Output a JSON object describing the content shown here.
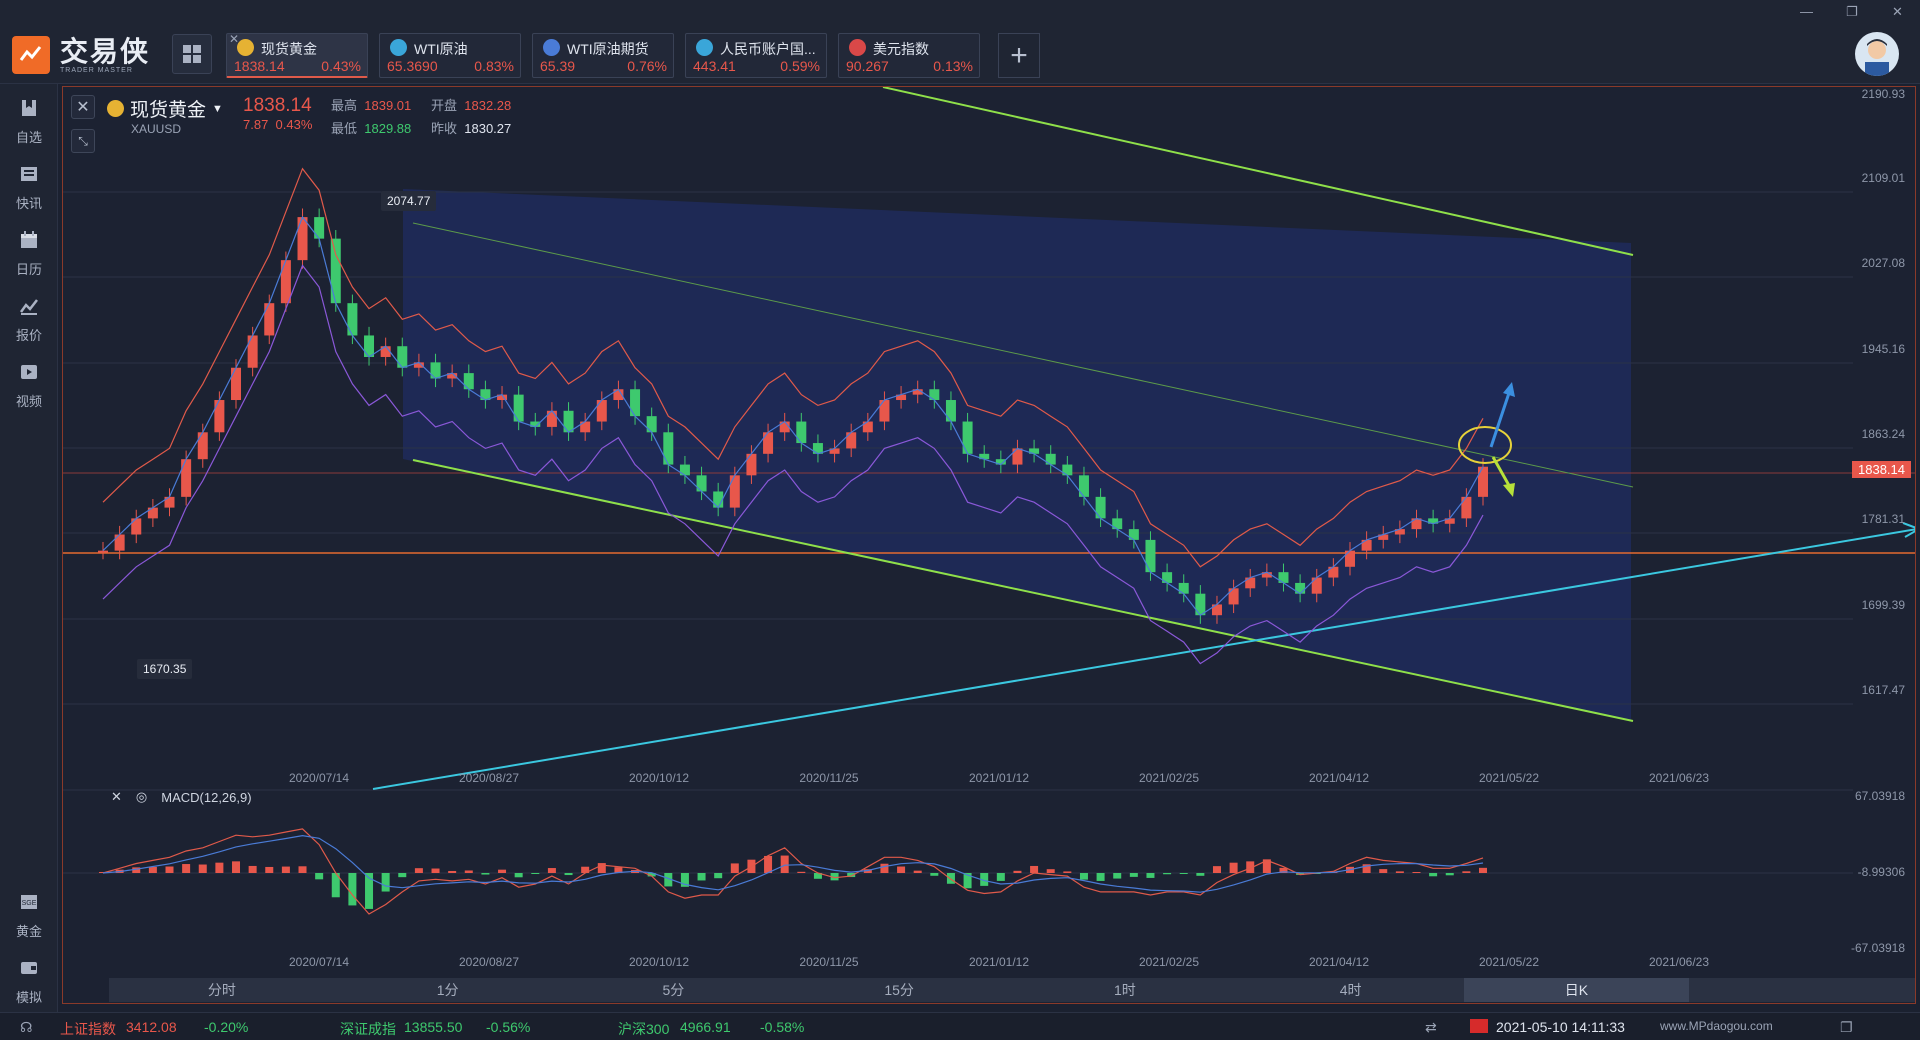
{
  "app": {
    "name_cn": "交易侠",
    "name_en": "TRADER MASTER"
  },
  "tabs": [
    {
      "name": "现货黄金",
      "price": "1838.14",
      "change": "0.43%",
      "active": true,
      "badge_color": "#e6b233"
    },
    {
      "name": "WTI原油",
      "price": "65.3690",
      "change": "0.83%",
      "active": false,
      "badge_color": "#3aa6d9"
    },
    {
      "name": "WTI原油期货",
      "price": "65.39",
      "change": "0.76%",
      "active": false,
      "badge_color": "#4a7bd6"
    },
    {
      "name": "人民币账户国...",
      "price": "443.41",
      "change": "0.59%",
      "active": false,
      "badge_color": "#3aa6d9"
    },
    {
      "name": "美元指数",
      "price": "90.267",
      "change": "0.13%",
      "active": false,
      "badge_color": "#d94848"
    }
  ],
  "sidebar": {
    "items": [
      {
        "label": "自选",
        "icon": "bookmark-icon"
      },
      {
        "label": "快讯",
        "icon": "news-icon"
      },
      {
        "label": "日历",
        "icon": "calendar-icon"
      },
      {
        "label": "报价",
        "icon": "quote-icon"
      },
      {
        "label": "视频",
        "icon": "video-icon"
      },
      {
        "label": "黄金",
        "icon": "sge-icon"
      },
      {
        "label": "模拟",
        "icon": "simulate-icon"
      }
    ]
  },
  "symbol": {
    "name": "现货黄金",
    "code": "XAUUSD",
    "price": "1838.14",
    "change": "7.87",
    "change_pct": "0.43%",
    "high_label": "最高",
    "high": "1839.01",
    "low_label": "最低",
    "low": "1829.88",
    "open_label": "开盘",
    "open": "1832.28",
    "prev_label": "昨收",
    "prev": "1830.27"
  },
  "chart_data": {
    "type": "candlestick",
    "y_ticks": [
      "2190.93",
      "2109.01",
      "2027.08",
      "1945.16",
      "1863.24",
      "1781.31",
      "1699.39",
      "1617.47"
    ],
    "x_ticks": [
      "2020/07/14",
      "2020/08/27",
      "2020/10/12",
      "2020/11/25",
      "2021/01/12",
      "2021/02/25",
      "2021/04/12",
      "2021/05/22",
      "2021/06/23"
    ],
    "last_price": "1838.14",
    "annotations": {
      "high": "2074.77",
      "low": "1670.35"
    },
    "series": [
      {
        "name": "close",
        "values": [
          1760,
          1775,
          1790,
          1800,
          1810,
          1845,
          1870,
          1900,
          1930,
          1960,
          1990,
          2030,
          2070,
          2050,
          1990,
          1960,
          1940,
          1950,
          1930,
          1935,
          1920,
          1925,
          1910,
          1900,
          1905,
          1880,
          1875,
          1890,
          1870,
          1880,
          1900,
          1910,
          1885,
          1870,
          1840,
          1830,
          1815,
          1800,
          1830,
          1850,
          1870,
          1880,
          1860,
          1850,
          1855,
          1870,
          1880,
          1900,
          1905,
          1910,
          1900,
          1880,
          1850,
          1845,
          1840,
          1855,
          1850,
          1840,
          1830,
          1810,
          1790,
          1780,
          1770,
          1740,
          1730,
          1720,
          1700,
          1710,
          1725,
          1735,
          1740,
          1730,
          1720,
          1735,
          1745,
          1760,
          1770,
          1775,
          1780,
          1790,
          1785,
          1790,
          1810,
          1838
        ]
      }
    ]
  },
  "macd": {
    "label": "MACD(12,26,9)",
    "y_ticks": [
      "67.03918",
      "-8.99306",
      "-67.03918"
    ],
    "x_ticks": [
      "2020/07/14",
      "2020/08/27",
      "2020/10/12",
      "2020/11/25",
      "2021/01/12",
      "2021/02/25",
      "2021/04/12",
      "2021/05/22",
      "2021/06/23"
    ]
  },
  "periods": [
    {
      "label": "分时",
      "active": false
    },
    {
      "label": "1分",
      "active": false
    },
    {
      "label": "5分",
      "active": false
    },
    {
      "label": "15分",
      "active": false
    },
    {
      "label": "1时",
      "active": false
    },
    {
      "label": "4时",
      "active": false
    },
    {
      "label": "日K",
      "active": true
    },
    {
      "label": "",
      "active": false
    }
  ],
  "status": {
    "sh_label": "上证指数",
    "sh_value": "3412.08",
    "sh_change": "-0.20%",
    "sz_label": "深证成指",
    "sz_value": "13855.50",
    "sz_change": "-0.56%",
    "hs_label": "沪深300",
    "hs_value": "4966.91",
    "hs_change": "-0.58%",
    "datetime": "2021-05-10 14:11:33",
    "watermark": "www.MPdaogou.com"
  }
}
